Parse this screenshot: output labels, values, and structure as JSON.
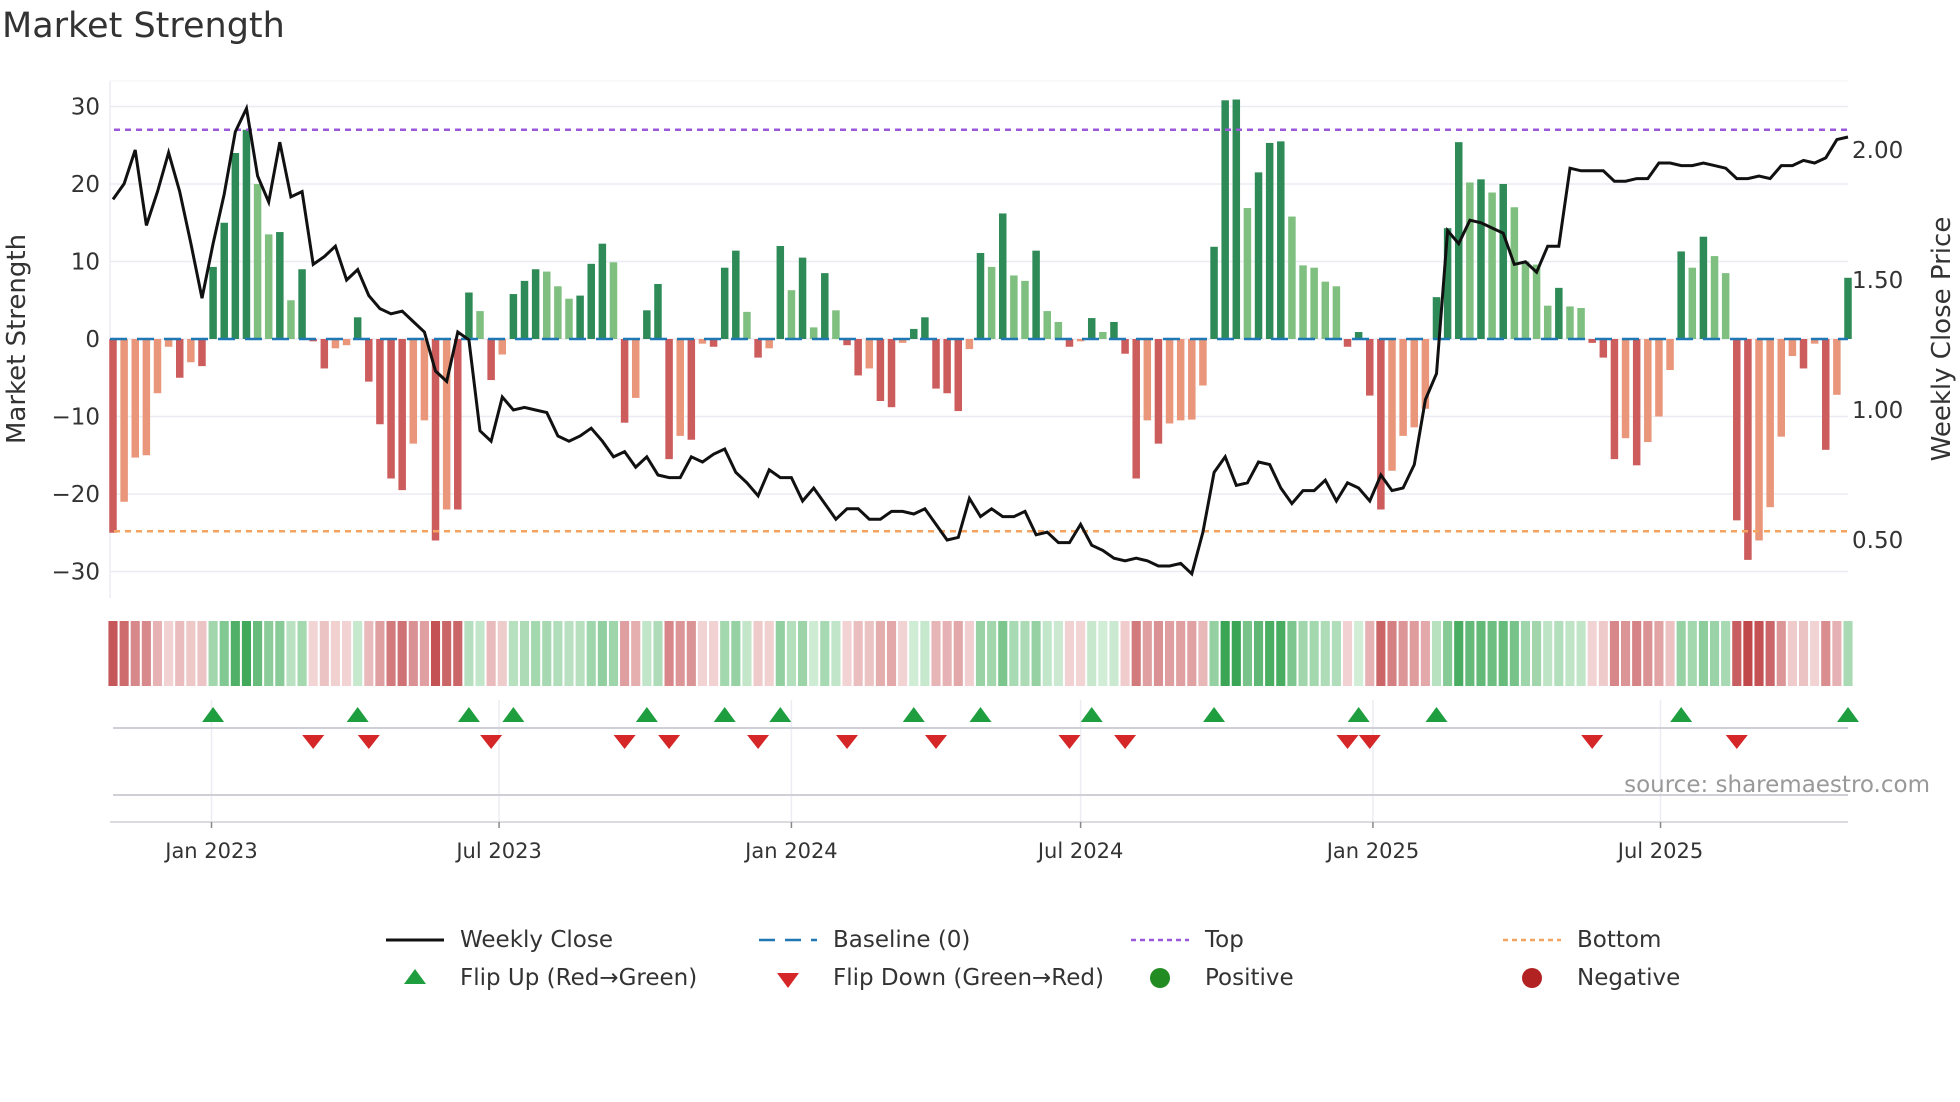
{
  "title": "Market Strength",
  "source": "source: sharemaestro.com",
  "legend": {
    "weekly_close": "Weekly Close",
    "baseline": "Baseline (0)",
    "top": "Top",
    "bottom": "Bottom",
    "flip_up": "Flip Up (Red→Green)",
    "flip_down": "Flip Down (Green→Red)",
    "positive": "Positive",
    "negative": "Negative"
  },
  "colors": {
    "strong_pos": "#2e8b57",
    "weak_pos": "#7fbf7f",
    "strong_neg": "#cd5c5c",
    "weak_neg": "#e9967a",
    "baseline": "#1f77b4",
    "top": "#9b59d9",
    "bottom": "#f4a460",
    "line": "#111111",
    "flip_up": "#1e9e3e",
    "flip_down": "#d62728",
    "positive": "#228b22",
    "negative": "#b22222"
  },
  "chart_data": {
    "type": "bar+line",
    "title": "Market Strength",
    "ylabel": "Market Strength",
    "y2label": "Weekly Close Price",
    "ylim": [
      -32.5,
      33
    ],
    "y_ticks": [
      30,
      20,
      10,
      0,
      -10,
      -20,
      -30
    ],
    "y2lim": [
      0.33,
      2.28
    ],
    "y2_ticks": [
      2.0,
      1.5,
      1.0,
      0.5
    ],
    "top_level": 27,
    "bottom_level": -24.8,
    "x_start": "2022-10-31",
    "frequency": "weekly",
    "x_ticks": [
      {
        "date": "2023-01-01",
        "label": "Jan 2023"
      },
      {
        "date": "2023-07-01",
        "label": "Jul 2023"
      },
      {
        "date": "2024-01-01",
        "label": "Jan 2024"
      },
      {
        "date": "2024-07-01",
        "label": "Jul 2024"
      },
      {
        "date": "2025-01-01",
        "label": "Jan 2025"
      },
      {
        "date": "2025-07-01",
        "label": "Jul 2025"
      }
    ],
    "strength": [
      -25,
      -21,
      -15.3,
      -15,
      -7,
      -1,
      -5,
      -3,
      -3.5,
      9.3,
      15,
      24,
      27,
      20,
      13.5,
      13.8,
      5,
      9,
      -0.3,
      -3.8,
      -1.2,
      -0.8,
      2.8,
      -5.5,
      -11,
      -18,
      -19.5,
      -13.5,
      -10.5,
      -26,
      -22,
      -22,
      6,
      3.6,
      -5.3,
      -2,
      5.8,
      7.5,
      9,
      8.7,
      6.8,
      5.2,
      5.6,
      9.7,
      12.3,
      9.9,
      -10.8,
      -7.6,
      3.7,
      7.1,
      -15.5,
      -12.5,
      -13,
      -0.6,
      -1,
      9.2,
      11.4,
      3.5,
      -2.4,
      -1.2,
      12,
      6.3,
      10.5,
      1.5,
      8.5,
      3.7,
      -0.8,
      -4.7,
      -3.8,
      -8,
      -8.8,
      -0.5,
      1.3,
      2.8,
      -6.4,
      -7,
      -9.3,
      -1.3,
      11.1,
      9.3,
      16.2,
      8.2,
      7.5,
      11.4,
      3.6,
      2.2,
      -1,
      -0.3,
      2.7,
      0.9,
      2.2,
      -1.9,
      -18,
      -10.5,
      -13.5,
      -10.9,
      -10.5,
      -10.4,
      -6,
      11.9,
      30.8,
      30.9,
      16.9,
      21.5,
      25.3,
      25.5,
      15.8,
      9.5,
      9.2,
      7.4,
      6.8,
      -1,
      0.9,
      -7.3,
      -22,
      -17,
      -12.5,
      -11.4,
      -9,
      5.4,
      14.3,
      25.4,
      20.2,
      20.6,
      18.9,
      20,
      17,
      10,
      9.6,
      4.3,
      6.6,
      4.2,
      4,
      -0.5,
      -2.4,
      -15.5,
      -12.8,
      -16.3,
      -13.3,
      -10,
      -4,
      11.3,
      9.2,
      13.2,
      10.7,
      8.5,
      -23.4,
      -28.5,
      -26,
      -21.7,
      -12.6,
      -2.2,
      -3.8,
      -0.6,
      -14.3,
      -7.2,
      7.9
    ],
    "weekly_close": [
      1.81,
      1.87,
      2.0,
      1.71,
      1.84,
      1.99,
      1.84,
      1.64,
      1.43,
      1.64,
      1.83,
      2.07,
      2.16,
      1.9,
      1.8,
      2.03,
      1.82,
      1.84,
      1.56,
      1.59,
      1.63,
      1.5,
      1.54,
      1.44,
      1.39,
      1.37,
      1.38,
      1.34,
      1.3,
      1.15,
      1.11,
      1.3,
      1.27,
      0.92,
      0.88,
      1.05,
      1.0,
      1.01,
      1.0,
      0.99,
      0.9,
      0.88,
      0.9,
      0.93,
      0.88,
      0.82,
      0.84,
      0.78,
      0.82,
      0.75,
      0.74,
      0.74,
      0.82,
      0.8,
      0.83,
      0.85,
      0.76,
      0.72,
      0.67,
      0.77,
      0.74,
      0.74,
      0.65,
      0.7,
      0.64,
      0.58,
      0.62,
      0.62,
      0.58,
      0.58,
      0.61,
      0.61,
      0.6,
      0.62,
      0.56,
      0.5,
      0.51,
      0.66,
      0.59,
      0.62,
      0.59,
      0.59,
      0.61,
      0.52,
      0.53,
      0.49,
      0.49,
      0.56,
      0.48,
      0.46,
      0.43,
      0.42,
      0.43,
      0.42,
      0.4,
      0.4,
      0.41,
      0.37,
      0.53,
      0.76,
      0.82,
      0.71,
      0.72,
      0.8,
      0.79,
      0.7,
      0.64,
      0.69,
      0.69,
      0.73,
      0.65,
      0.72,
      0.7,
      0.65,
      0.75,
      0.69,
      0.7,
      0.79,
      1.04,
      1.14,
      1.69,
      1.64,
      1.73,
      1.72,
      1.7,
      1.68,
      1.56,
      1.57,
      1.53,
      1.63,
      1.63,
      1.93,
      1.92,
      1.92,
      1.92,
      1.88,
      1.88,
      1.89,
      1.89,
      1.95,
      1.95,
      1.94,
      1.94,
      1.95,
      1.94,
      1.93,
      1.89,
      1.89,
      1.9,
      1.89,
      1.94,
      1.94,
      1.96,
      1.95,
      1.97,
      2.04,
      2.05
    ],
    "flip_up_weeks": [
      9,
      22,
      32,
      36,
      48,
      55,
      60,
      72,
      78,
      88,
      99,
      112,
      119,
      141,
      156
    ],
    "flip_down_weeks": [
      18,
      23,
      34,
      46,
      50,
      58,
      66,
      74,
      86,
      91,
      111,
      113,
      133,
      146
    ]
  }
}
